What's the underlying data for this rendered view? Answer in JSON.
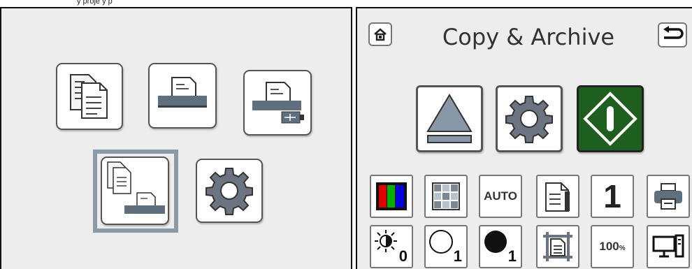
{
  "header_fragment": "y proje                 y    p",
  "left_panel": {
    "tiles": [
      {
        "name": "copy-tile",
        "icon": "copy-documents-icon"
      },
      {
        "name": "scan-tile",
        "icon": "scanner-icon"
      },
      {
        "name": "scan-to-usb-tile",
        "icon": "scanner-usb-icon"
      },
      {
        "name": "copy-and-archive-tile",
        "icon": "copy-scan-icon",
        "selected": true
      },
      {
        "name": "settings-tile",
        "icon": "gear-icon"
      }
    ]
  },
  "right_panel": {
    "title": "Copy & Archive",
    "home_icon": "home-icon",
    "back_icon": "back-arrow-icon",
    "main_buttons": [
      {
        "name": "eject-button",
        "icon": "eject-icon"
      },
      {
        "name": "settings-button",
        "icon": "gear-icon"
      },
      {
        "name": "start-button",
        "icon": "start-icon",
        "color": "#1e5e1e"
      }
    ],
    "row1": [
      {
        "name": "color-mode-button",
        "icon": "color-mode-icon"
      },
      {
        "name": "grid-button",
        "icon": "grid-icon"
      },
      {
        "name": "auto-button",
        "label": "AUTO"
      },
      {
        "name": "document-button",
        "icon": "document-icon"
      },
      {
        "name": "copies-button",
        "label": "1"
      },
      {
        "name": "printer-button",
        "icon": "printer-icon"
      }
    ],
    "row2": [
      {
        "name": "brightness-button",
        "icon": "brightness-icon",
        "value": "0"
      },
      {
        "name": "white-level-button",
        "icon": "white-circle-icon",
        "value": "1"
      },
      {
        "name": "black-level-button",
        "icon": "black-circle-icon",
        "value": "1"
      },
      {
        "name": "page-frame-button",
        "icon": "page-frame-icon"
      },
      {
        "name": "zoom-button",
        "label": "100",
        "unit": "%"
      },
      {
        "name": "display-button",
        "icon": "display-icon"
      }
    ]
  }
}
